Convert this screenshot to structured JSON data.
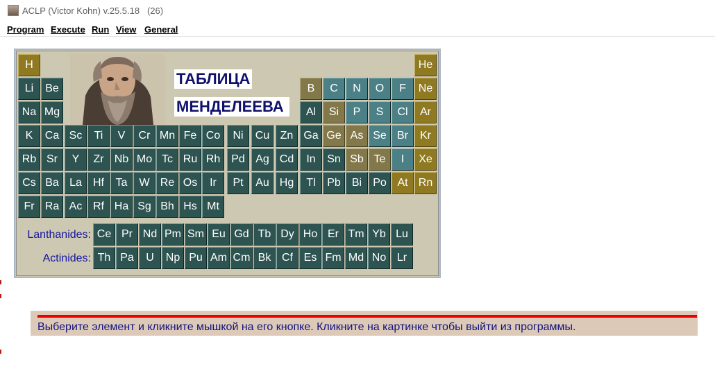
{
  "window": {
    "title": "ACLP (Victor Kohn) v.25.5.18",
    "count": "(26)"
  },
  "menu": [
    "Program",
    "Execute",
    "Run",
    "View",
    "General"
  ],
  "table": {
    "title_line1": "ТАБЛИЦА",
    "title_line2": "МЕНДЕЛЕЕВА",
    "lanthanides_label": "Lanthanides:",
    "actinides_label": "Actinides:",
    "rows": [
      [
        [
          "H",
          "o"
        ]
      ],
      [
        [
          "Li",
          "d"
        ],
        [
          "Be",
          "d"
        ]
      ],
      [
        [
          "Na",
          "d"
        ],
        [
          "Mg",
          "d"
        ]
      ],
      [
        [
          "K",
          "d"
        ],
        [
          "Ca",
          "d"
        ],
        [
          "Sc",
          "d"
        ],
        [
          "Ti",
          "d"
        ],
        [
          "V",
          "d"
        ],
        [
          "Cr",
          "d"
        ],
        [
          "Mn",
          "d"
        ],
        [
          "Fe",
          "d"
        ],
        [
          "Co",
          "d"
        ],
        [
          "Ni",
          "d"
        ],
        [
          "Cu",
          "d"
        ],
        [
          "Zn",
          "d"
        ],
        [
          "Ga",
          "d"
        ],
        [
          "Ge",
          "k"
        ],
        [
          "As",
          "k"
        ],
        [
          "Se",
          "t"
        ],
        [
          "Br",
          "t"
        ],
        [
          "Kr",
          "o"
        ]
      ],
      [
        [
          "Rb",
          "d"
        ],
        [
          "Sr",
          "d"
        ],
        [
          "Y",
          "d"
        ],
        [
          "Zr",
          "d"
        ],
        [
          "Nb",
          "d"
        ],
        [
          "Mo",
          "d"
        ],
        [
          "Tc",
          "d"
        ],
        [
          "Ru",
          "d"
        ],
        [
          "Rh",
          "d"
        ],
        [
          "Pd",
          "d"
        ],
        [
          "Ag",
          "d"
        ],
        [
          "Cd",
          "d"
        ],
        [
          "In",
          "d"
        ],
        [
          "Sn",
          "d"
        ],
        [
          "Sb",
          "k"
        ],
        [
          "Te",
          "k"
        ],
        [
          "I",
          "t"
        ],
        [
          "Xe",
          "o"
        ]
      ],
      [
        [
          "Cs",
          "d"
        ],
        [
          "Ba",
          "d"
        ],
        [
          "La",
          "d"
        ],
        [
          "Hf",
          "d"
        ],
        [
          "Ta",
          "d"
        ],
        [
          "W",
          "d"
        ],
        [
          "Re",
          "d"
        ],
        [
          "Os",
          "d"
        ],
        [
          "Ir",
          "d"
        ],
        [
          "Pt",
          "d"
        ],
        [
          "Au",
          "d"
        ],
        [
          "Hg",
          "d"
        ],
        [
          "Tl",
          "d"
        ],
        [
          "Pb",
          "d"
        ],
        [
          "Bi",
          "d"
        ],
        [
          "Po",
          "d"
        ],
        [
          "At",
          "o"
        ],
        [
          "Rn",
          "o"
        ]
      ],
      [
        [
          "Fr",
          "d"
        ],
        [
          "Ra",
          "d"
        ],
        [
          "Ac",
          "d"
        ],
        [
          "Rf",
          "d"
        ],
        [
          "Ha",
          "d"
        ],
        [
          "Sg",
          "d"
        ],
        [
          "Bh",
          "d"
        ],
        [
          "Hs",
          "d"
        ],
        [
          "Mt",
          "d"
        ]
      ]
    ],
    "row1_right": [
      [
        "He",
        "o"
      ]
    ],
    "row2_right": [
      [
        "B",
        "k"
      ],
      [
        "C",
        "t"
      ],
      [
        "N",
        "t"
      ],
      [
        "O",
        "t"
      ],
      [
        "F",
        "t"
      ],
      [
        "Ne",
        "o"
      ]
    ],
    "row3_right": [
      [
        "Al",
        "d"
      ],
      [
        "Si",
        "k"
      ],
      [
        "P",
        "t"
      ],
      [
        "S",
        "t"
      ],
      [
        "Cl",
        "t"
      ],
      [
        "Ar",
        "o"
      ]
    ],
    "lanthanides": [
      "Ce",
      "Pr",
      "Nd",
      "Pm",
      "Sm",
      "Eu",
      "Gd",
      "Tb",
      "Dy",
      "Ho",
      "Er",
      "Tm",
      "Yb",
      "Lu"
    ],
    "actinides": [
      "Th",
      "Pa",
      "U",
      "Np",
      "Pu",
      "Am",
      "Cm",
      "Bk",
      "Cf",
      "Es",
      "Fm",
      "Md",
      "No",
      "Lr"
    ]
  },
  "status": {
    "message": "Выберите элемент и кликните мышкой на его кнопке. Кликните на картинке чтобы выйти из программы."
  },
  "colors": {
    "dark_teal": "#2d5450",
    "light_teal": "#4b8186",
    "gold": "#8f7a22",
    "khaki": "#83784a",
    "panel": "#cdc8b1",
    "status_bar": "#dcc9b8",
    "status_line": "#ee0000",
    "label_blue": "#1515a0"
  }
}
